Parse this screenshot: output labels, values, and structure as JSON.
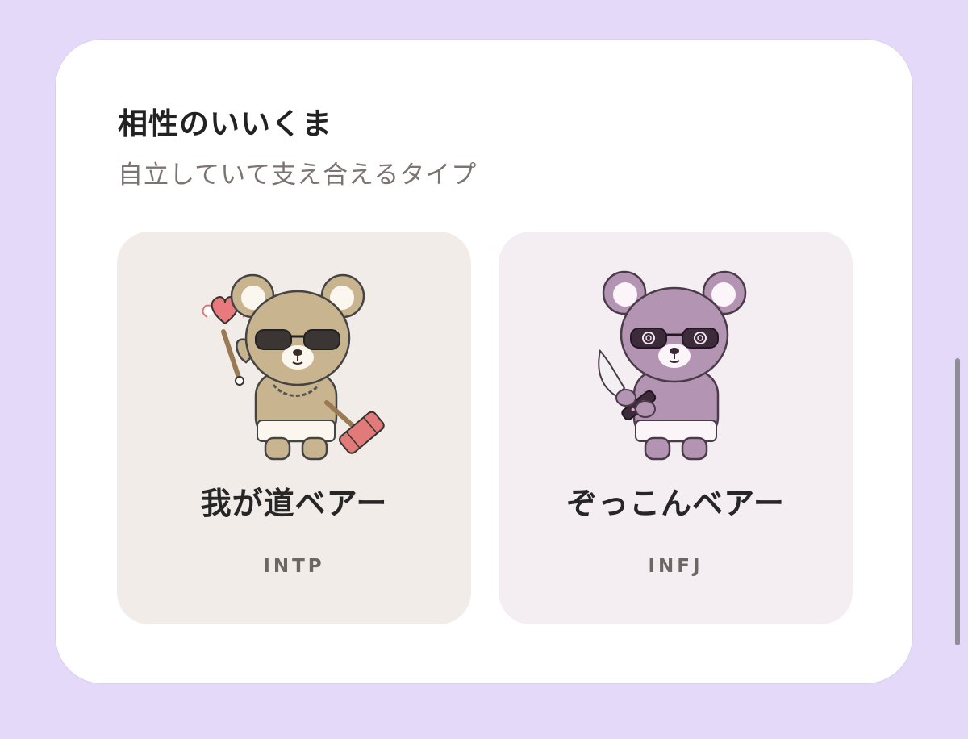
{
  "section": {
    "title": "相性のいいくま",
    "subtitle": "自立していて支え合えるタイプ"
  },
  "bears": [
    {
      "name": "我が道ベアー",
      "type": "INTP",
      "tile_color": "#f1ece7",
      "fur_color": "#c8b48e",
      "icon": "bear-with-heart-wand-and-hammer-icon"
    },
    {
      "name": "ぞっこんベアー",
      "type": "INFJ",
      "tile_color": "#f4eef3",
      "fur_color": "#b494b3",
      "icon": "bear-with-knife-icon"
    }
  ],
  "colors": {
    "background": "#e4d9f9",
    "card": "#ffffff",
    "scrollbar": "#8f8d96"
  }
}
